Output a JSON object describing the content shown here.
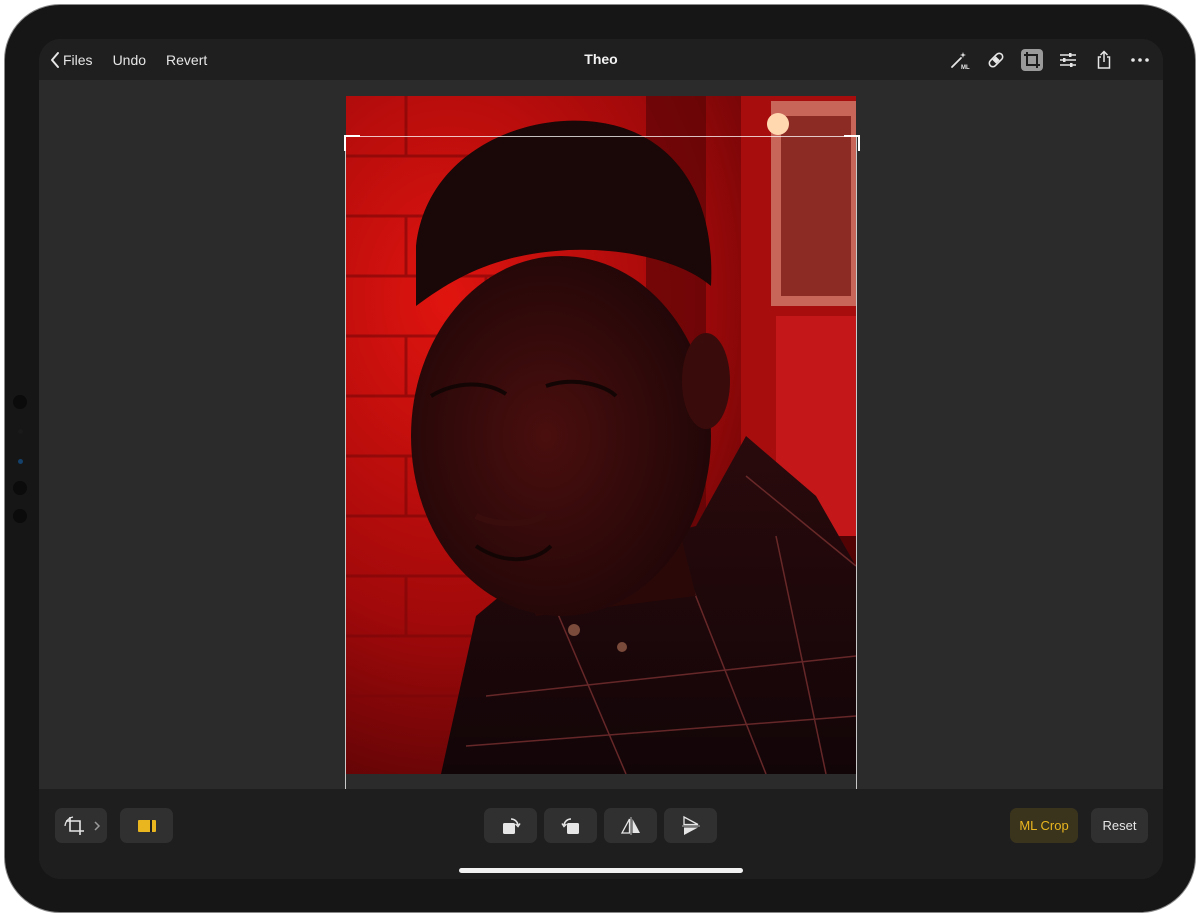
{
  "topbar": {
    "back_label": "Files",
    "undo_label": "Undo",
    "revert_label": "Revert",
    "title": "Theo",
    "right_icons": [
      "magic-wand-ml-icon",
      "bandage-icon",
      "crop-icon",
      "adjustments-icon",
      "share-icon",
      "more-icon"
    ],
    "active_tool": "crop-icon",
    "ml_badge": "ML"
  },
  "photo": {
    "description_icon": "portrait-photo",
    "aspect": "portrait"
  },
  "bottombar": {
    "left_tools": [
      "crop-rotate-icon",
      "aspect-ratio-icon"
    ],
    "center_tools": [
      "rotate-right-icon",
      "rotate-left-icon",
      "flip-horizontal-icon",
      "flip-vertical-icon"
    ],
    "ml_crop_label": "ML Crop",
    "reset_label": "Reset"
  },
  "colors": {
    "accent": "#e9b61f",
    "background": "#2b2b2b",
    "bar": "#1e1e1e"
  }
}
